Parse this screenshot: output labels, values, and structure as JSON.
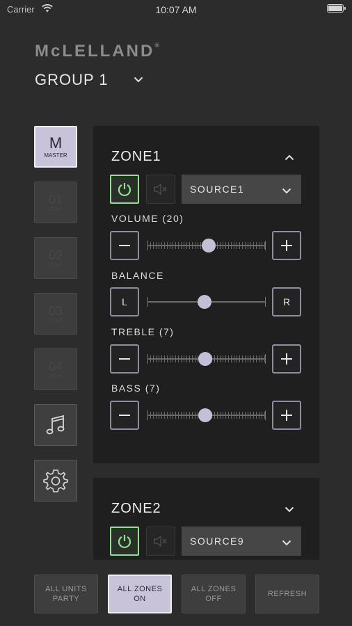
{
  "status_bar": {
    "carrier": "Carrier",
    "time": "10:07 AM"
  },
  "header": {
    "logo_text": "McLELLAND",
    "logo_mark": "®",
    "group_label": "GROUP 1"
  },
  "rail": {
    "master": {
      "big": "M",
      "small": "MASTER"
    },
    "zones": [
      {
        "big": "01",
        "small": "ZONE"
      },
      {
        "big": "02",
        "small": "ZONE"
      },
      {
        "big": "03",
        "small": "ZONE"
      },
      {
        "big": "04",
        "small": "ZONE"
      }
    ],
    "icons": [
      "music-note-icon",
      "gear-icon"
    ]
  },
  "zones": [
    {
      "title": "ZONE1",
      "expanded": true,
      "power_on": true,
      "muted": false,
      "source": "SOURCE1",
      "controls": {
        "volume": {
          "label": "VOLUME (20)",
          "value_fraction": 0.52
        },
        "balance": {
          "label": "BALANCE",
          "left": "L",
          "right": "R",
          "value_fraction": 0.48
        },
        "treble": {
          "label": "TREBLE (7)",
          "value_fraction": 0.49
        },
        "bass": {
          "label": "BASS (7)",
          "value_fraction": 0.49
        }
      }
    },
    {
      "title": "ZONE2",
      "expanded": false,
      "power_on": true,
      "muted": false,
      "source": "SOURCE9"
    }
  ],
  "bottom_bar": {
    "all_units_party": "ALL UNITS\nPARTY",
    "all_zones_on": "ALL ZONES\nON",
    "all_zones_off": "ALL ZONES\nOFF",
    "refresh": "REFRESH"
  },
  "colors": {
    "background": "#2c2c2c",
    "card": "#1f1f1f",
    "accent": "#c8c3d8",
    "power_on": "#8fe08f"
  }
}
